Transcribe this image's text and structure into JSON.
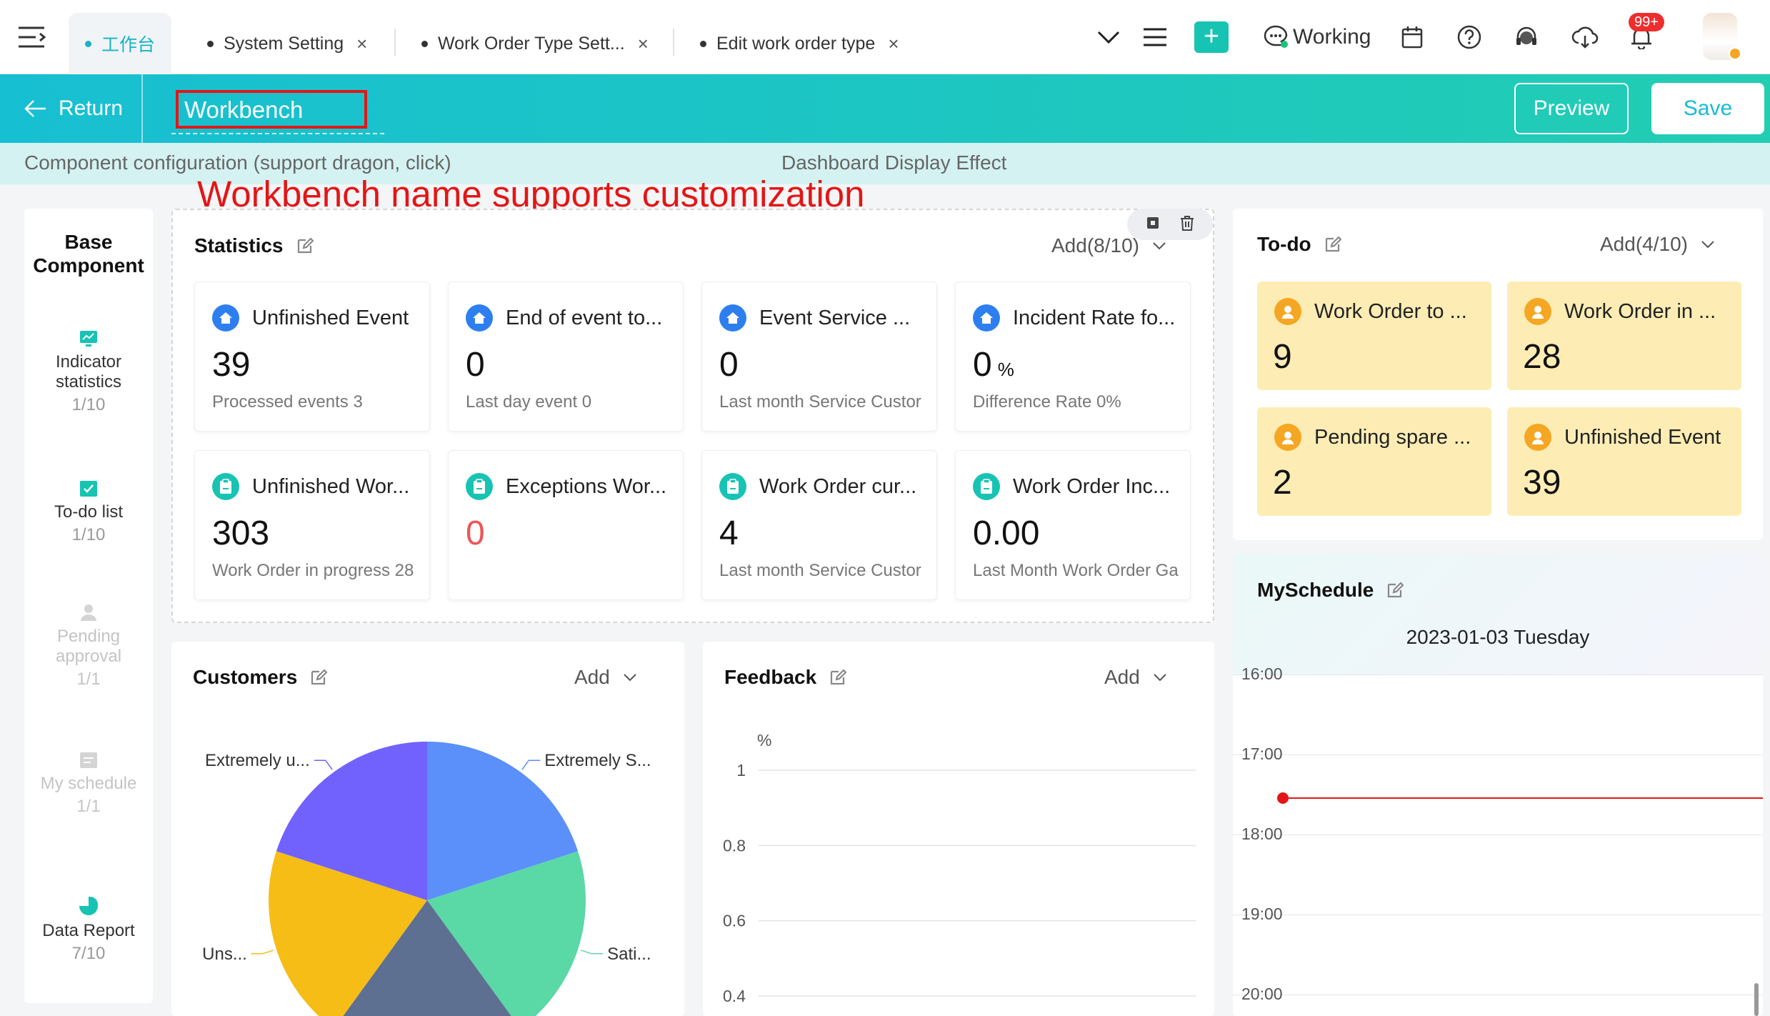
{
  "tabs": [
    {
      "label": "工作台",
      "active": true
    },
    {
      "label": "System Setting",
      "active": false
    },
    {
      "label": "Work Order Type Sett...",
      "active": false
    },
    {
      "label": "Edit work order type",
      "active": false
    }
  ],
  "topbar": {
    "working_label": "Working",
    "notification_badge": "99+",
    "icons": [
      "menu-icon",
      "chevron-down-icon",
      "list-icon",
      "plus-icon",
      "chat-icon",
      "calendar-icon",
      "help-icon",
      "headset-icon",
      "cloud-download-icon",
      "bell-icon",
      "avatar"
    ]
  },
  "header": {
    "return_label": "Return",
    "workbench_name": "Workbench",
    "preview_label": "Preview",
    "save_label": "Save"
  },
  "subbar": {
    "left": "Component configuration (support dragon, click)",
    "right": "Dashboard Display Effect"
  },
  "annotation": "Workbench name supports customization",
  "left_panel": {
    "title": "Base Component",
    "items": [
      {
        "label": "Indicator statistics",
        "count": "1/10",
        "enabled": true,
        "icon": "chart-icon"
      },
      {
        "label": "To-do list",
        "count": "1/10",
        "enabled": true,
        "icon": "checklist-icon"
      },
      {
        "label": "Pending approval",
        "count": "1/1",
        "enabled": false,
        "icon": "user-icon"
      },
      {
        "label": "My schedule",
        "count": "1/1",
        "enabled": false,
        "icon": "calendar-icon"
      },
      {
        "label": "Data Report",
        "count": "7/10",
        "enabled": true,
        "icon": "pie-chart-icon"
      }
    ]
  },
  "statistics": {
    "title": "Statistics",
    "add_label": "Add(8/10)",
    "tiles": [
      {
        "title": "Unfinished Event",
        "value": "39",
        "unit": "",
        "sub": "Processed events  3",
        "icon": "home-icon",
        "value_color": "#111111"
      },
      {
        "title": "End of event to...",
        "value": "0",
        "unit": "",
        "sub": "Last day event  0",
        "icon": "home-icon",
        "value_color": "#111111"
      },
      {
        "title": "Event Service ...",
        "value": "0",
        "unit": "",
        "sub": "Last month Service Custor",
        "icon": "home-icon",
        "value_color": "#111111"
      },
      {
        "title": "Incident Rate fo...",
        "value": "0",
        "unit": "%",
        "sub": "Difference Rate  0%",
        "icon": "home-icon",
        "value_color": "#111111"
      },
      {
        "title": "Unfinished Wor...",
        "value": "303",
        "unit": "",
        "sub": "Work Order in progress  28",
        "icon": "clipboard-icon",
        "value_color": "#111111"
      },
      {
        "title": "Exceptions Wor...",
        "value": "0",
        "unit": "",
        "sub": "",
        "icon": "clipboard-icon",
        "value_color": "#ee5555"
      },
      {
        "title": "Work Order cur...",
        "value": "4",
        "unit": "",
        "sub": "Last month Service Custor",
        "icon": "clipboard-icon",
        "value_color": "#111111"
      },
      {
        "title": "Work Order Inc...",
        "value": "0.00",
        "unit": "",
        "sub": "Last Month Work Order Ga",
        "icon": "clipboard-icon",
        "value_color": "#111111"
      }
    ]
  },
  "todo": {
    "title": "To-do",
    "add_label": "Add(4/10)",
    "tiles": [
      {
        "title": "Work Order to ...",
        "value": "9"
      },
      {
        "title": "Work Order in ...",
        "value": "28"
      },
      {
        "title": "Pending spare ...",
        "value": "2"
      },
      {
        "title": "Unfinished Event",
        "value": "39"
      }
    ]
  },
  "schedule": {
    "title": "MySchedule",
    "date": "2023-01-03 Tuesday",
    "hours": [
      "16:00",
      "17:00",
      "18:00",
      "19:00",
      "20:00"
    ],
    "current_time_fraction": 0.55
  },
  "customers": {
    "title": "Customers",
    "add_label": "Add"
  },
  "feedback": {
    "title": "Feedback",
    "add_label": "Add"
  },
  "chart_data": [
    {
      "type": "pie",
      "title": "Customers",
      "categories": [
        "Extremely S...",
        "Sati...",
        "",
        "Uns...",
        "Extremely u..."
      ],
      "values": [
        20,
        20,
        20,
        20,
        20
      ],
      "colors": [
        "#5b8ff9",
        "#5ad8a6",
        "#5d7092",
        "#f6bd16",
        "#7262fd"
      ]
    },
    {
      "type": "line",
      "title": "Feedback",
      "ylabel": "%",
      "yticks": [
        "1",
        "0.8",
        "0.6",
        "0.4"
      ],
      "ylim": [
        0.4,
        1
      ],
      "series": []
    }
  ]
}
